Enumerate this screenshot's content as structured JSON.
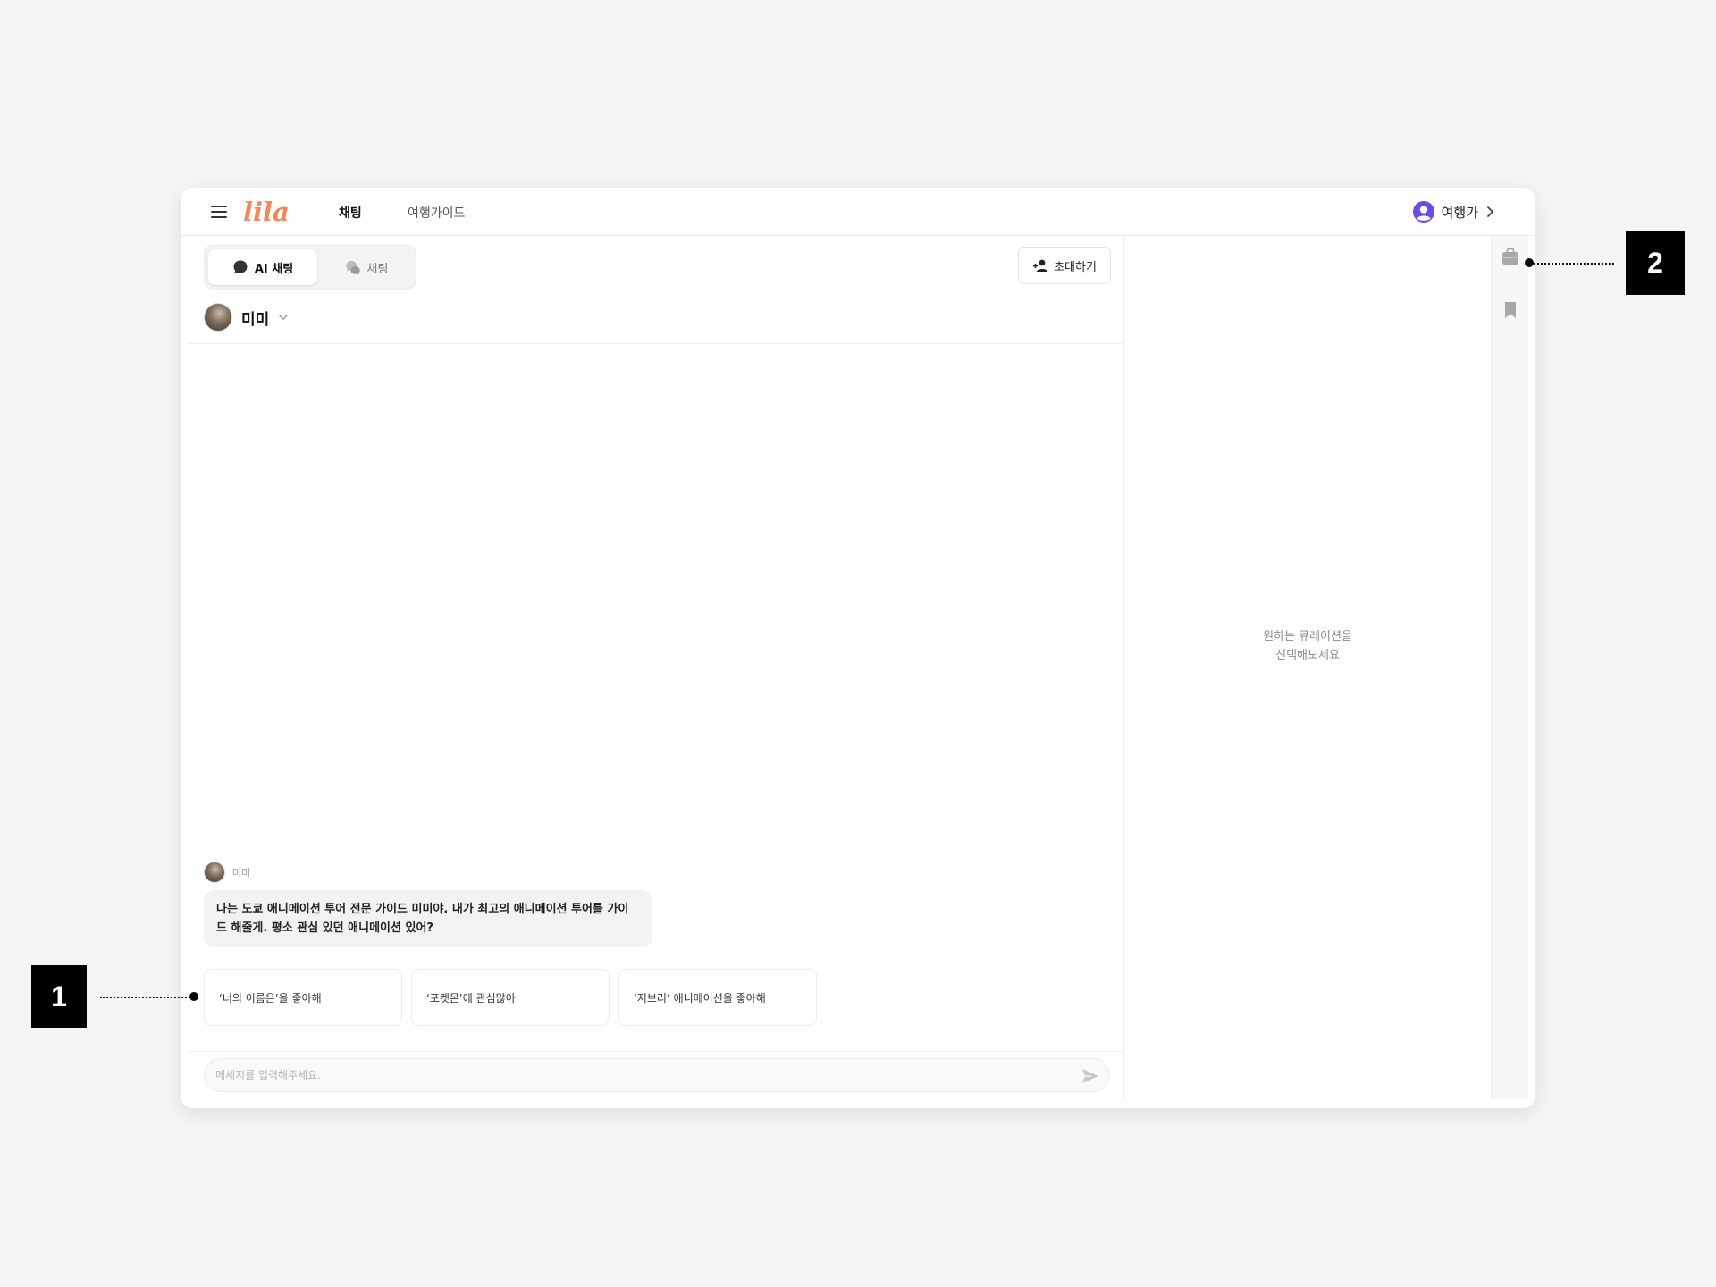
{
  "app": {
    "logo_text": "lila",
    "nav_tabs": [
      {
        "label": "채팅",
        "active": true
      },
      {
        "label": "여행가이드",
        "active": false
      }
    ],
    "user_label": "여행가"
  },
  "chat": {
    "segments": [
      {
        "label": "AI 채팅",
        "active": true
      },
      {
        "label": "채팅",
        "active": false
      }
    ],
    "invite_label": "초대하기",
    "persona_name": "미미",
    "message": {
      "sender": "미미",
      "text_line1": "나는 도쿄 애니메이션 투어 전문 가이드 미미야. 내가 최고의 애니메이션 투어를 가이",
      "text_line2": "드 해줄게. 평소 관심 있던 애니메이션 있어?"
    },
    "suggestions": [
      "‘너의 이름은’을 좋아해",
      "‘포켓몬’에 관심많아",
      "‘지브리’ 애니메이션을 좋아해"
    ],
    "input_placeholder": "메세지를 입력해주세요."
  },
  "curation": {
    "empty_line1": "원하는 큐레이션을",
    "empty_line2": "선택해보세요"
  },
  "side_rail": {
    "icons": [
      "briefcase-icon",
      "bookmark-icon"
    ]
  },
  "annotations": {
    "callout_1": "1",
    "callout_2": "2"
  },
  "colors": {
    "logo": "#f08a5d",
    "user_icon": "#6b4de6",
    "rail_icon": "#a8a8a8",
    "send_icon": "#c7c7c7"
  }
}
